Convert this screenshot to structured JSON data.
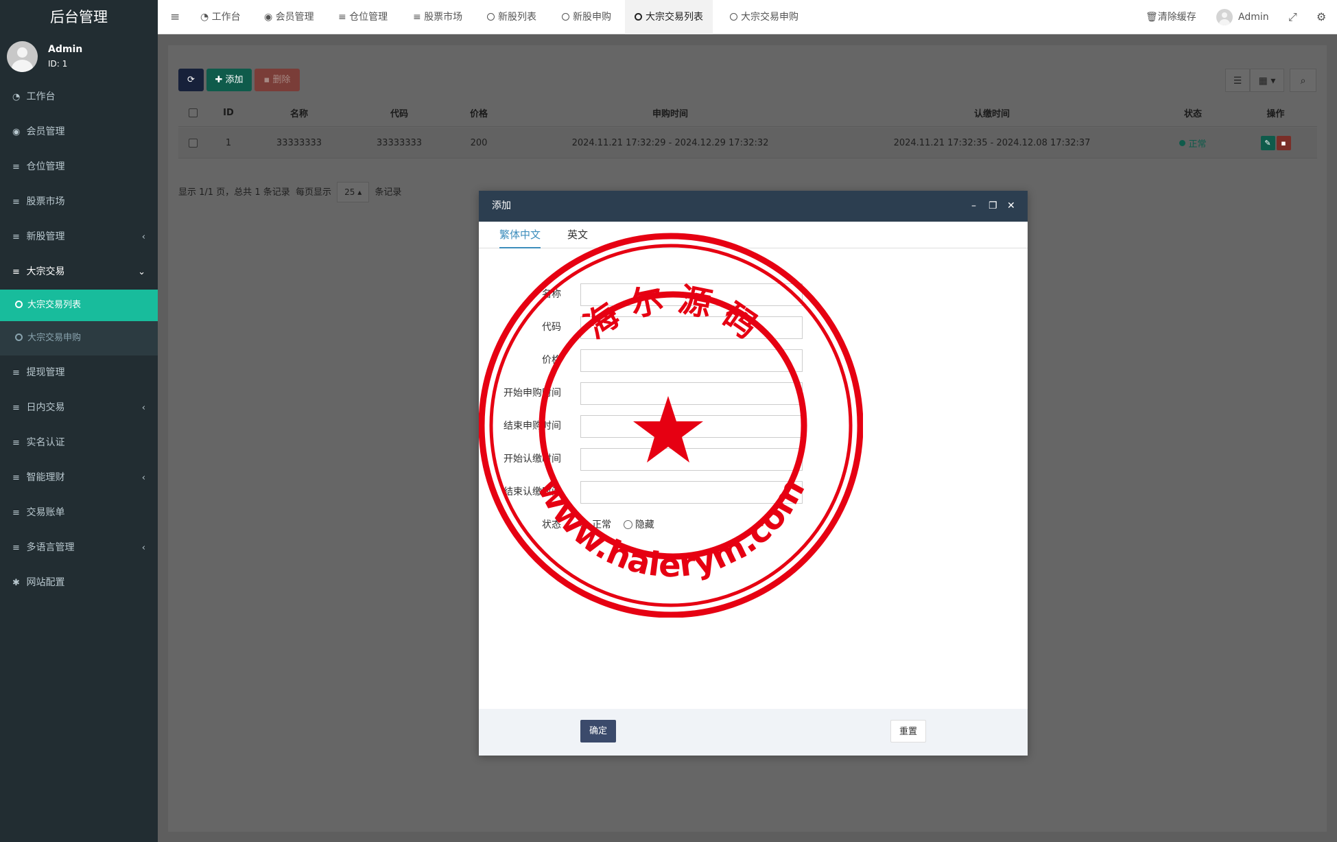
{
  "sidebar": {
    "title": "后台管理",
    "user": {
      "name": "Admin",
      "id_text": "ID: 1"
    },
    "items": [
      {
        "label": "工作台",
        "icon": "dashboard-icon"
      },
      {
        "label": "会员管理",
        "icon": "user-circle-icon"
      },
      {
        "label": "仓位管理",
        "icon": "list-icon"
      },
      {
        "label": "股票市场",
        "icon": "list-icon"
      },
      {
        "label": "新股管理",
        "icon": "list-icon",
        "arrow": "‹"
      },
      {
        "label": "大宗交易",
        "icon": "list-icon",
        "arrow": "⌄"
      },
      {
        "label": "提现管理",
        "icon": "list-icon"
      },
      {
        "label": "日内交易",
        "icon": "list-icon",
        "arrow": "‹"
      },
      {
        "label": "实名认证",
        "icon": "list-icon"
      },
      {
        "label": "智能理财",
        "icon": "list-icon",
        "arrow": "‹"
      },
      {
        "label": "交易账单",
        "icon": "list-icon"
      },
      {
        "label": "多语言管理",
        "icon": "list-icon",
        "arrow": "‹"
      },
      {
        "label": "网站配置",
        "icon": "gear-icon"
      }
    ],
    "subitems": [
      {
        "label": "大宗交易列表"
      },
      {
        "label": "大宗交易申购"
      }
    ]
  },
  "topbar": {
    "tabs": [
      {
        "label": "工作台"
      },
      {
        "label": "会员管理"
      },
      {
        "label": "仓位管理"
      },
      {
        "label": "股票市场"
      },
      {
        "label": "新股列表"
      },
      {
        "label": "新股申购"
      },
      {
        "label": "大宗交易列表"
      },
      {
        "label": "大宗交易申购"
      }
    ],
    "clear_cache": "清除缓存",
    "user": "Admin"
  },
  "toolbar": {
    "add_label": "添加",
    "delete_label": "删除"
  },
  "table": {
    "headers": [
      "ID",
      "名称",
      "代码",
      "价格",
      "申购时间",
      "认缴时间",
      "状态",
      "操作"
    ],
    "rows": [
      {
        "id": "1",
        "name": "33333333",
        "code": "33333333",
        "price": "200",
        "subscribe_time": "2024.11.21 17:32:29 - 2024.12.29 17:32:32",
        "pay_time": "2024.11.21 17:32:35 - 2024.12.08 17:32:37",
        "status": "正常"
      }
    ]
  },
  "pager": {
    "summary": "显示 1/1 页，总共 1 条记录",
    "per_page_prefix": "每页显示",
    "per_page_value": "25",
    "per_page_suffix": "条记录"
  },
  "modal": {
    "title": "添加",
    "tabs": [
      "繁体中文",
      "英文"
    ],
    "fields": [
      {
        "label": "名称",
        "value": ""
      },
      {
        "label": "代码",
        "value": ""
      },
      {
        "label": "价格",
        "value": ""
      },
      {
        "label": "开始申购时间",
        "value": ""
      },
      {
        "label": "结束申购时间",
        "value": ""
      },
      {
        "label": "开始认缴时间",
        "value": ""
      },
      {
        "label": "结束认缴时间",
        "value": ""
      }
    ],
    "status_label": "状态",
    "status_options": [
      "正常",
      "隐藏"
    ],
    "ok_label": "确定",
    "reset_label": "重置"
  },
  "stamp": {
    "top_text": "海 尔 源 码",
    "bottom_text": "www.haierym.com"
  },
  "colors": {
    "sidebar_bg": "#222d32",
    "active_green": "#18bc9c",
    "modal_header": "#2c3e50",
    "stamp_red": "#e60012"
  }
}
